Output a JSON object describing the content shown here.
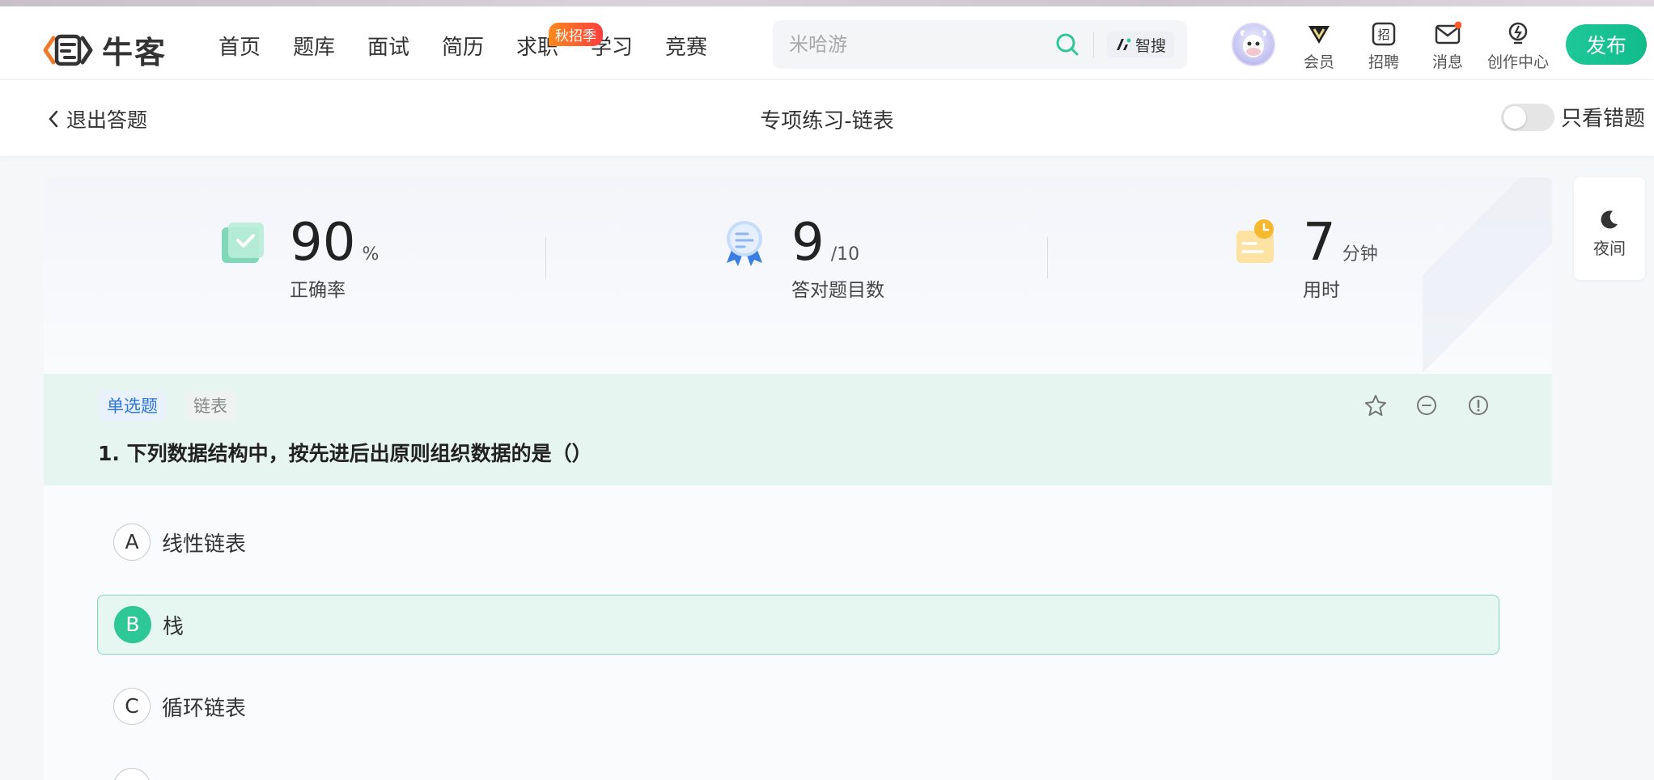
{
  "header": {
    "logo_text": "牛客",
    "nav": [
      "首页",
      "题库",
      "面试",
      "简历",
      "求职",
      "学习",
      "竞赛"
    ],
    "nav_badge": "秋招季",
    "search_placeholder": "米哈游",
    "zhisou_label": "智搜",
    "icons": [
      {
        "label": "会员",
        "icon": "vip-icon"
      },
      {
        "label": "招聘",
        "icon": "recruit-icon"
      },
      {
        "label": "消息",
        "icon": "mail-icon"
      },
      {
        "label": "创作中心",
        "icon": "lightbulb-icon"
      }
    ],
    "publish_label": "发布"
  },
  "subheader": {
    "back_label": "退出答题",
    "title": "专项练习-链表",
    "toggle_label": "只看错题"
  },
  "stats": [
    {
      "value": "90",
      "unit": "%",
      "label": "正确率",
      "icon": "accuracy-icon"
    },
    {
      "value": "9",
      "unit": "/10",
      "label": "答对题目数",
      "icon": "medal-icon"
    },
    {
      "value": "7",
      "unit": "分钟",
      "label": "用时",
      "icon": "clock-icon"
    }
  ],
  "question": {
    "type_tag": "单选题",
    "topic_tag": "链表",
    "text": "1. 下列数据结构中，按先进后出原则组织数据的是（）",
    "options": [
      {
        "letter": "A",
        "text": "线性链表",
        "selected": false
      },
      {
        "letter": "B",
        "text": "栈",
        "selected": true
      },
      {
        "letter": "C",
        "text": "循环链表",
        "selected": false
      }
    ]
  },
  "night_mode_label": "夜间",
  "colors": {
    "brand_green": "#11bb8a",
    "selected_bg": "#e6f7f1",
    "question_bg": "#e6f5f0"
  }
}
